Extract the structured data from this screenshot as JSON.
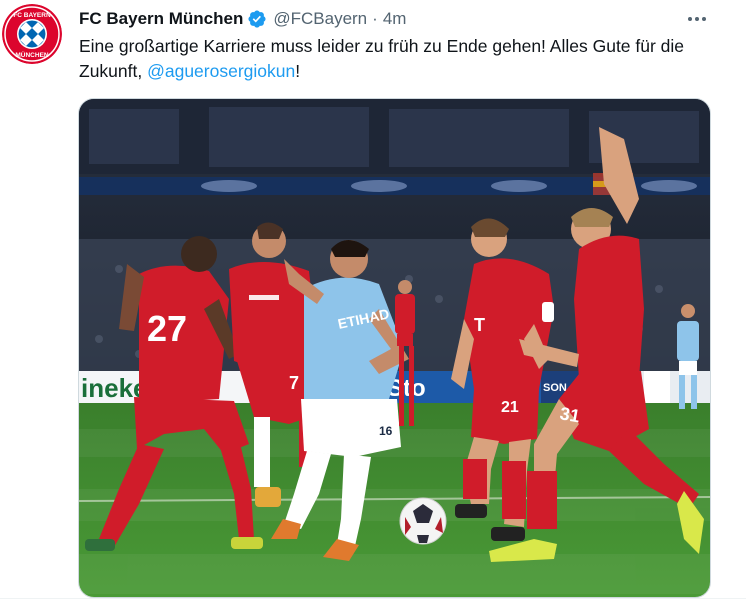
{
  "tweet": {
    "author_name": "FC Bayern München",
    "handle": "@FCBayern",
    "separator": "·",
    "timestamp": "4m",
    "text_main": "Eine großartige Karriere muss leider zu früh zu Ende gehen! Alles Gute für die Zukunft, ",
    "mention": "@aguerosergiokun",
    "text_end": "!",
    "more_icon": "more-horizontal-icon",
    "verified_icon": "verified-badge-icon"
  },
  "avatar": {
    "logo_text_top": "FC BAYERN",
    "logo_text_bottom": "MÜNCHEN",
    "colors": {
      "red": "#dc052d",
      "blue": "#0066b2",
      "white": "#ffffff"
    }
  },
  "media": {
    "jersey_numbers": [
      "27",
      "7",
      "21",
      "31",
      "16"
    ],
    "board_text_left": "ineke",
    "board_text_mid": "Sto",
    "board_text_right": "SON",
    "colors": {
      "pitch": "#3f8a2e",
      "stands": "#1b2230",
      "bayern_red": "#d01c2a",
      "city_blue": "#8ec4ea"
    }
  },
  "colors": {
    "accent": "#1d9bf0",
    "text": "#0f1419",
    "secondary": "#536471"
  }
}
